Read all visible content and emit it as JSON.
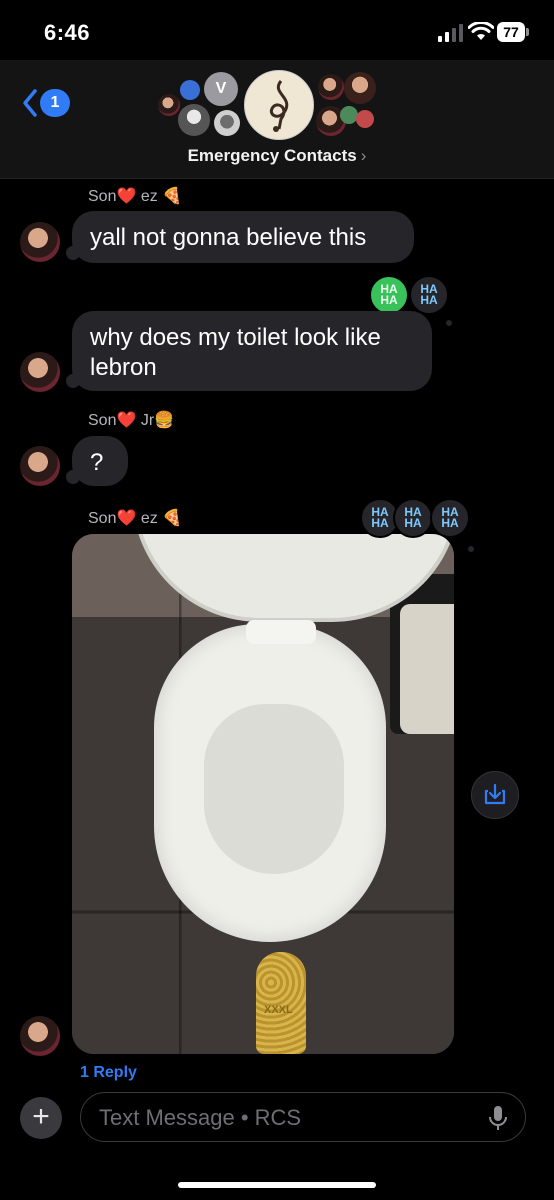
{
  "status_bar": {
    "time": "6:46",
    "battery": "77"
  },
  "header": {
    "back_badge": "1",
    "group_avatar_letter": "V",
    "title": "Emergency Contacts",
    "title_chevron": "›"
  },
  "messages": [
    {
      "sender": "Son❤️ ez 🍕",
      "text": "yall not gonna believe this"
    },
    {
      "sender": "",
      "text": "why does my toilet look like lebron",
      "reactions": [
        "HA HA",
        "HA HA"
      ]
    },
    {
      "sender": "Son❤️ Jr🍔",
      "text": "?"
    },
    {
      "sender": "Son❤️ ez 🍕",
      "type": "photo",
      "reactions": [
        "HA HA",
        "HA HA",
        "HA HA"
      ],
      "photo_label": "XXXL"
    }
  ],
  "thread": {
    "reply_link": "1 Reply"
  },
  "composer": {
    "placeholder": "Text Message • RCS",
    "plus_label": "+"
  },
  "icons": [
    "back-chevron-icon",
    "signal-icon",
    "wifi-icon",
    "battery-icon",
    "save-to-photos-icon",
    "microphone-icon"
  ]
}
